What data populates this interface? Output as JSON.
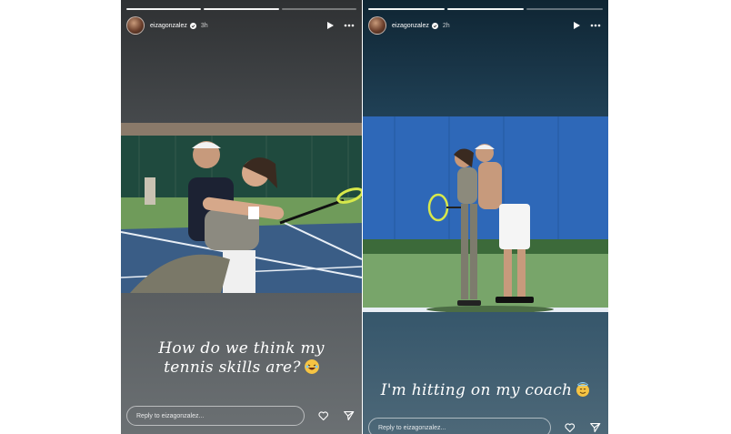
{
  "stories": [
    {
      "username": "eizagonzalez",
      "time": "3h",
      "caption_line1": "How do we think my",
      "caption_line2": "tennis skills are?",
      "reply_placeholder": "Reply to eizagonzalez..."
    },
    {
      "username": "eizagonzalez",
      "time": "2h",
      "caption_line1": "I'm hitting on my coach",
      "reply_placeholder": "Reply to eizagonzalez..."
    }
  ],
  "icons": {
    "verified": "verified-badge-icon",
    "play": "play-icon",
    "more": "more-options-icon",
    "like": "heart-icon",
    "share": "send-icon",
    "emoji_left": "laughing-emoji-icon",
    "emoji_right": "smiling-halo-emoji-icon"
  },
  "colors": {
    "left_bg": "#4b4f52",
    "right_bg": "#22445a",
    "court_green": "#6f9b5a",
    "court_blue": "#3a5d86"
  }
}
